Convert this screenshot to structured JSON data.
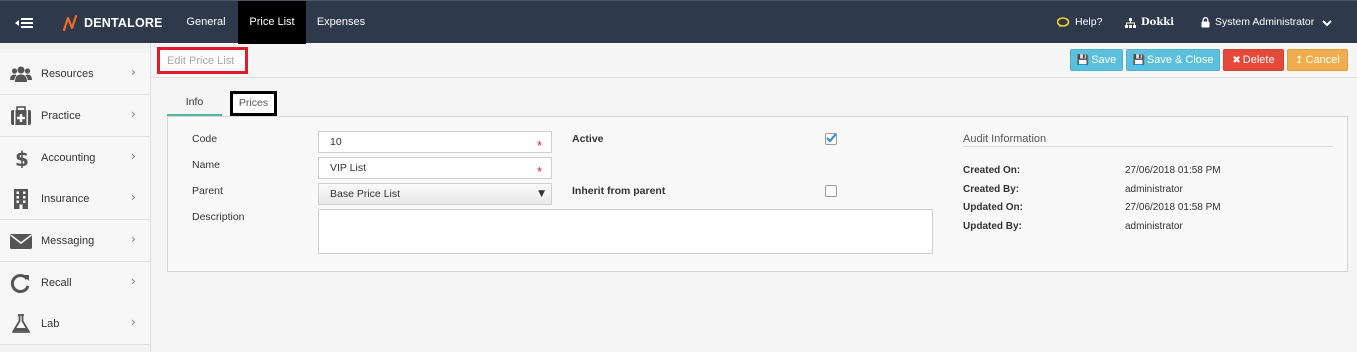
{
  "app": {
    "brand": "DENTALORE"
  },
  "nav": {
    "general": "General",
    "price_list": "Price List",
    "expenses": "Expenses"
  },
  "topbar": {
    "help": "Help?",
    "branch": "Dokki",
    "user": "System Administrator"
  },
  "sidebar": {
    "items": [
      {
        "label": "Resources",
        "icon": "users-icon"
      },
      {
        "label": "Practice",
        "icon": "medical-kit-icon"
      },
      {
        "label": "Accounting",
        "icon": "dollar-icon"
      },
      {
        "label": "Insurance",
        "icon": "building-icon"
      },
      {
        "label": "Messaging",
        "icon": "envelope-icon"
      },
      {
        "label": "Recall",
        "icon": "refresh-icon"
      },
      {
        "label": "Lab",
        "icon": "flask-icon"
      }
    ],
    "chevron": "›"
  },
  "page": {
    "title": "Edit Price List"
  },
  "toolbar": {
    "save": "Save",
    "save_close": "Save & Close",
    "delete": "Delete",
    "cancel": "Cancel"
  },
  "tabs": {
    "info": "Info",
    "prices": "Prices"
  },
  "form": {
    "code_label": "Code",
    "code_value": "10",
    "name_label": "Name",
    "name_value": "VIP List",
    "parent_label": "Parent",
    "parent_value": "Base Price List",
    "description_label": "Description",
    "description_value": "",
    "active_label": "Active",
    "active_checked": true,
    "inherit_label": "Inherit from parent",
    "inherit_checked": false,
    "required_mark": "*"
  },
  "audit": {
    "title": "Audit Information",
    "created_on_label": "Created On:",
    "created_on": "27/06/2018 01:58 PM",
    "created_by_label": "Created By:",
    "created_by": "administrator",
    "updated_on_label": "Updated On:",
    "updated_on": "27/06/2018 01:58 PM",
    "updated_by_label": "Updated By:",
    "updated_by": "administrator"
  },
  "colors": {
    "topbar": "#2e3a4c",
    "accent_tab": "#4fb89a",
    "save": "#5bc0de",
    "delete": "#e5493a",
    "cancel": "#f0ad4e",
    "highlight": "#e21b2c"
  }
}
